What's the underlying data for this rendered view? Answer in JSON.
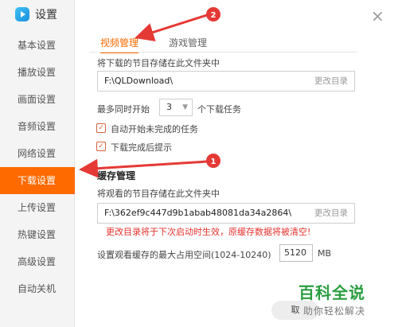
{
  "app": {
    "title": "设置"
  },
  "sidebar": {
    "items": [
      {
        "label": "基本设置"
      },
      {
        "label": "播放设置"
      },
      {
        "label": "画面设置"
      },
      {
        "label": "音频设置"
      },
      {
        "label": "网络设置"
      },
      {
        "label": "下载设置",
        "active": true
      },
      {
        "label": "上传设置"
      },
      {
        "label": "热键设置"
      },
      {
        "label": "高级设置"
      },
      {
        "label": "自动关机"
      }
    ]
  },
  "tabs": [
    {
      "label": "视频管理",
      "active": true
    },
    {
      "label": "游戏管理"
    }
  ],
  "download": {
    "store_label": "将下载的节目存储在此文件夹中",
    "path": "F:\\QLDownload\\",
    "change_dir": "更改目录",
    "concurrent_prefix": "最多同时开始",
    "concurrent_value": "3",
    "concurrent_suffix": "个下载任务",
    "auto_start": "自动开始未完成的任务",
    "notify_done": "下载完成后提示"
  },
  "cache": {
    "heading": "缓存管理",
    "store_label": "将观看的节目存储在此文件夹中",
    "path": "F:\\362ef9c447d9b1abab48081da34a2864\\",
    "change_dir": "更改目录",
    "warning": "更改目录将于下次启动时生效，原缓存数据将被清空!",
    "max_label": "设置观看缓存的最大占用空间(1024-10240)",
    "max_value": "5120",
    "unit": "MB"
  },
  "footer": {
    "button_partial": "取"
  },
  "annotations": {
    "badge1": "1",
    "badge2": "2"
  },
  "watermark": {
    "title": "百科全说",
    "subtitle": "助你轻松解决"
  },
  "colors": {
    "accent": "#ff6a00",
    "arrow": "#e53935",
    "warning": "#e5322d",
    "watermark": "#2a9d3f"
  },
  "icons": {
    "logo": "play-logo-icon",
    "close": "close-icon",
    "dropdown": "chevron-down-icon",
    "checkbox": "checkmark-icon"
  }
}
